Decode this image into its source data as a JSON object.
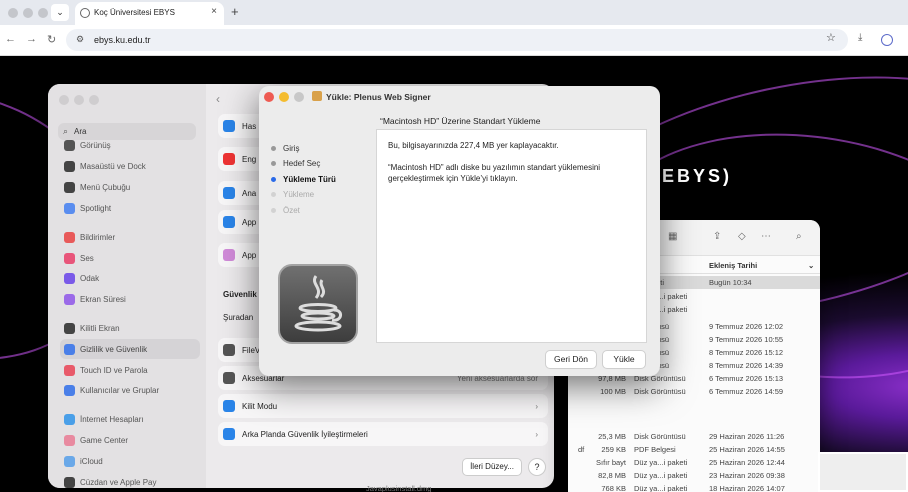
{
  "browser": {
    "tab_title": "Koç Üniversitesi EBYS",
    "url": "ebys.ku.edu.tr"
  },
  "page": {
    "brand_fragment": "EBYS)"
  },
  "settings": {
    "search_placeholder": "Ara",
    "sidebar": [
      {
        "label": "Görünüş",
        "color": "#555"
      },
      {
        "label": "Masaüstü ve Dock",
        "color": "#444"
      },
      {
        "label": "Menü Çubuğu",
        "color": "#444"
      },
      {
        "label": "Spotlight",
        "color": "#5a8def"
      },
      {
        "label": "Bildirimler",
        "color": "#e85a5a"
      },
      {
        "label": "Ses",
        "color": "#e8557a"
      },
      {
        "label": "Odak",
        "color": "#7a5ae8"
      },
      {
        "label": "Ekran Süresi",
        "color": "#9b6ae8"
      },
      {
        "label": "Kilitli Ekran",
        "color": "#444"
      },
      {
        "label": "Gizlilik ve Güvenlik",
        "color": "#4a7fe8"
      },
      {
        "label": "Touch ID ve Parola",
        "color": "#e85a6a"
      },
      {
        "label": "Kullanıcılar ve Gruplar",
        "color": "#4a7fe8"
      },
      {
        "label": "İnternet Hesapları",
        "color": "#4a9fe8"
      },
      {
        "label": "Game Center",
        "color": "#e88aa0"
      },
      {
        "label": "iCloud",
        "color": "#6aa8e8"
      },
      {
        "label": "Cüzdan ve Apple Pay",
        "color": "#444"
      }
    ],
    "rows_top": [
      "Has",
      "Eng",
      "Ana",
      "App",
      "App"
    ],
    "section": "Güvenlik",
    "row_source": "Şuradan",
    "rows": [
      {
        "label": "FileV",
        "right": ""
      },
      {
        "label": "Aksesuarlar",
        "right": "Yeni aksesuarlarda sor"
      },
      {
        "label": "Kilit Modu",
        "right": ""
      },
      {
        "label": "Arka Planda Güvenlik İyileştirmeleri",
        "right": ""
      }
    ],
    "advanced_button": "İleri Düzey...",
    "help_button": "?"
  },
  "finder": {
    "column_header": "Ekleniş Tarihi",
    "rows": [
      {
        "size": "",
        "kind": "...i paketi",
        "date": "Bugün 10:34"
      },
      {
        "size": "",
        "kind": "Görüntüsü",
        "date": "9 Temmuz 2026 12:02"
      },
      {
        "size": "",
        "kind": "Görüntüsü",
        "date": "9 Temmuz 2026 10:55"
      },
      {
        "size": "",
        "kind": "Görüntüsü",
        "date": "8 Temmuz 2026 15:12"
      },
      {
        "size": "",
        "kind": "Görüntüsü",
        "date": "8 Temmuz 2026 14:39"
      },
      {
        "size": "97,8 MB",
        "kind": "Disk Görüntüsü",
        "date": "6 Temmuz 2026 15:13"
      },
      {
        "size": "100 MB",
        "kind": "Disk Görüntüsü",
        "date": "6 Temmuz 2026 14:59"
      },
      {
        "size": "25,3 MB",
        "kind": "Disk Görüntüsü",
        "date": "29 Haziran 2026 11:26"
      },
      {
        "size": "259 KB",
        "kind": "PDF Belgesi",
        "date": "25 Haziran 2026 14:55"
      },
      {
        "size": "Sıfır bayt",
        "kind": "Düz ya...i paketi",
        "date": "25 Haziran 2026 12:44"
      },
      {
        "size": "82,8 MB",
        "kind": "Düz ya...i paketi",
        "date": "23 Haziran 2026 09:38"
      },
      {
        "size": "768 KB",
        "kind": "Düz ya...i paketi",
        "date": "18 Haziran 2026 14:07"
      }
    ],
    "partial_kinds": [
      "Düz ya...i paketi",
      "Düz ya...i paketi"
    ],
    "fragments": {
      "df": "df",
      "filename": "Javaplusinstall.dmg"
    }
  },
  "installer": {
    "title": "Yükle: Plenus Web Signer",
    "steps": [
      {
        "label": "Giriş",
        "state": "done"
      },
      {
        "label": "Hedef Seç",
        "state": "done"
      },
      {
        "label": "Yükleme Türü",
        "state": "current"
      },
      {
        "label": "Yükleme",
        "state": "pending"
      },
      {
        "label": "Özet",
        "state": "pending"
      }
    ],
    "heading": "“Macintosh HD” Üzerine Standart Yükleme",
    "line1": "Bu, bilgisayarınızda 227,4 MB yer kaplayacaktır.",
    "line2": "“Macintosh HD” adlı diske bu yazılımın standart yüklemesini gerçekleştirmek için Yükle’yi tıklayın.",
    "back_button": "Geri Dön",
    "install_button": "Yükle"
  }
}
